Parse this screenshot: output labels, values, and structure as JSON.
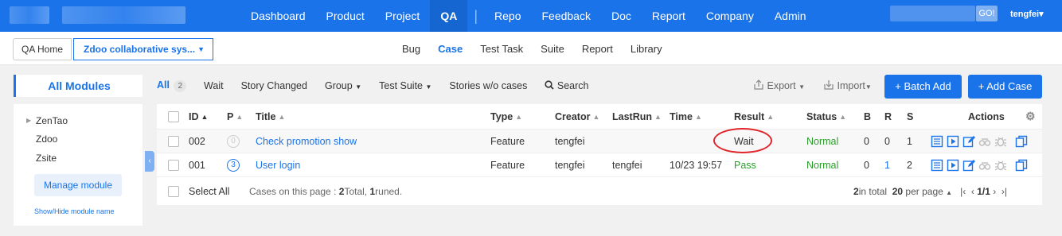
{
  "topnav": {
    "items": [
      "Dashboard",
      "Product",
      "Project",
      "QA",
      "Repo",
      "Feedback",
      "Doc",
      "Report",
      "Company",
      "Admin"
    ],
    "active": "QA",
    "search_button": "GO!",
    "user": "tengfei"
  },
  "subbar": {
    "home": "QA Home",
    "product": "Zdoo collaborative sys...",
    "tabs": [
      "Bug",
      "Case",
      "Test Task",
      "Suite",
      "Report",
      "Library"
    ],
    "active_tab": "Case"
  },
  "sidebar": {
    "title": "All Modules",
    "modules": [
      "ZenTao",
      "Zdoo",
      "Zsite"
    ],
    "manage_label": "Manage module",
    "showhide_label": "Show/Hide module name"
  },
  "featurebar": {
    "all_label": "All",
    "all_count": "2",
    "wait": "Wait",
    "story_changed": "Story Changed",
    "group": "Group",
    "test_suite": "Test Suite",
    "stories_wo_cases": "Stories w/o cases",
    "search": "Search",
    "export": "Export",
    "import": "Import",
    "batch_add": "Batch Add",
    "add_case": "Add Case"
  },
  "table": {
    "headers": {
      "id": "ID",
      "p": "P",
      "title": "Title",
      "type": "Type",
      "creator": "Creator",
      "lastrun": "LastRun",
      "time": "Time",
      "result": "Result",
      "status": "Status",
      "b": "B",
      "r": "R",
      "s": "S",
      "actions": "Actions"
    },
    "rows": [
      {
        "id": "002",
        "pri": "0",
        "title": "Check promotion show",
        "type": "Feature",
        "creator": "tengfei",
        "lastrun": "",
        "time": "",
        "result": "Wait",
        "status": "Normal",
        "b": "0",
        "r": "0",
        "s": "1"
      },
      {
        "id": "001",
        "pri": "3",
        "title": "User login",
        "type": "Feature",
        "creator": "tengfei",
        "lastrun": "tengfei",
        "time": "10/23 19:57",
        "result": "Pass",
        "status": "Normal",
        "b": "0",
        "r": "1",
        "s": "2"
      }
    ],
    "footer": {
      "select_all": "Select All",
      "summary_prefix": "Cases on this page : ",
      "total_count": "2",
      "total_label": " Total, ",
      "runed_count": "1",
      "runed_label": " runed.",
      "pager_total_count": "2",
      "pager_total_label": " in total",
      "per_page_count": "20",
      "per_page_label": " per page",
      "page": "1/1"
    }
  },
  "colors": {
    "primary": "#1a73e8",
    "success": "#2d9c2d",
    "highlight_ring": "#e0262b"
  }
}
